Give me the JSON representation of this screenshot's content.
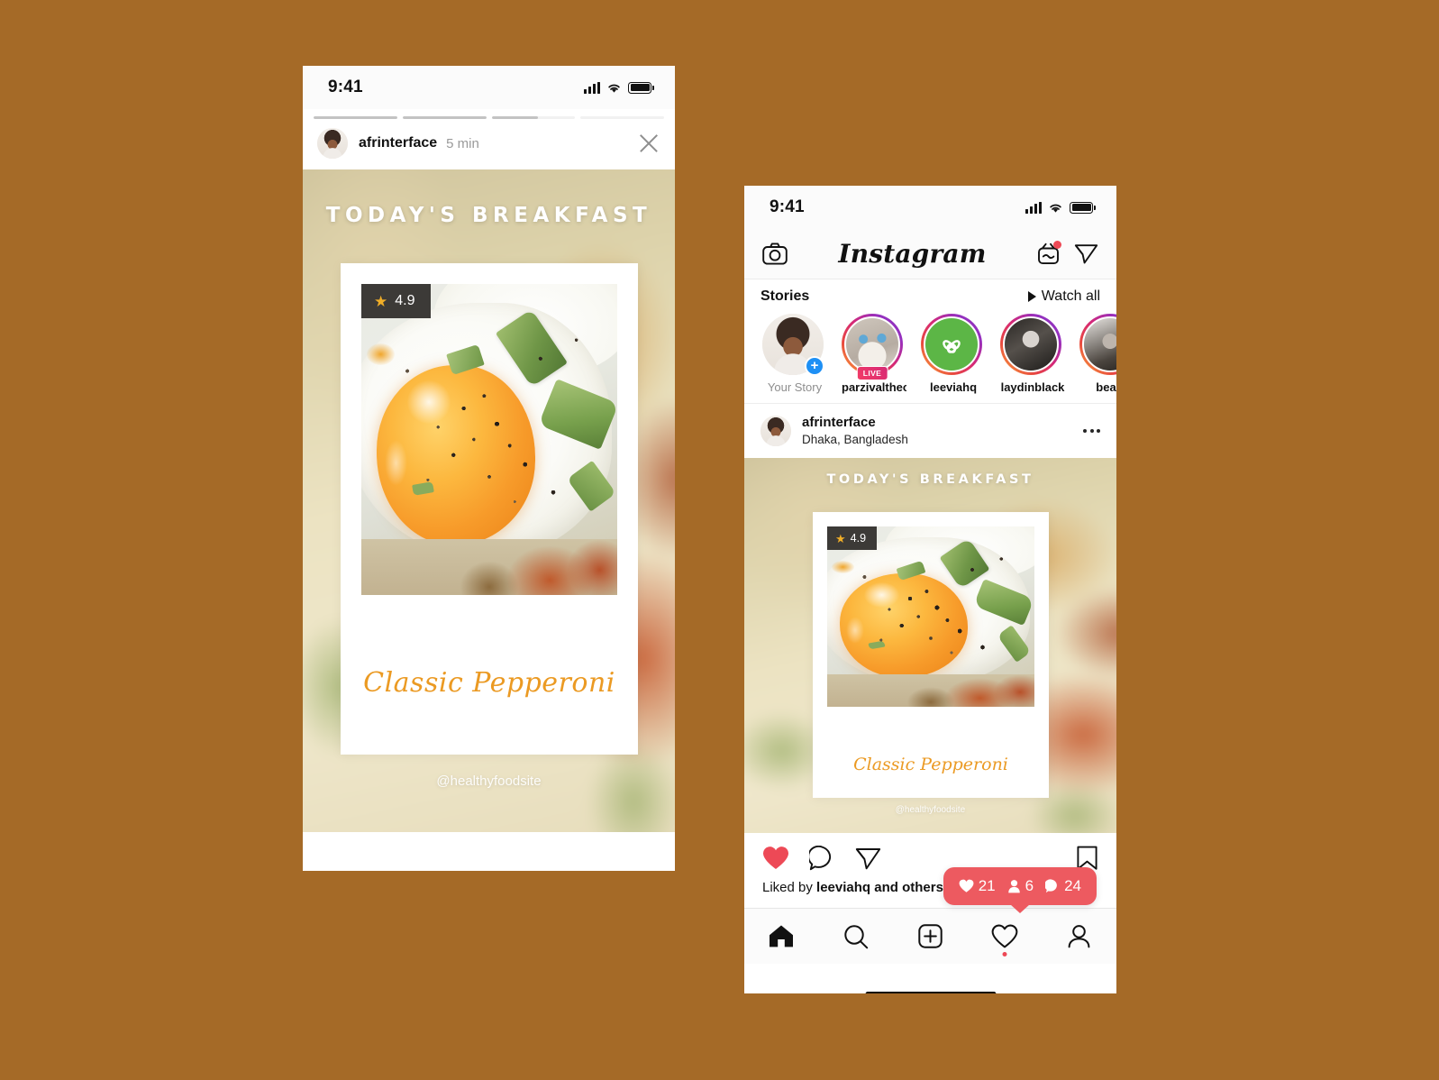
{
  "page": {
    "background_color": "#a56a27"
  },
  "story_phone": {
    "status_bar": {
      "time": "9:41",
      "signal_icon": "cellular-bars-icon",
      "wifi_icon": "wifi-icon",
      "battery_icon": "battery-full-icon"
    },
    "progress": {
      "segments": 4,
      "fills": [
        100,
        100,
        55,
        0
      ]
    },
    "header": {
      "avatar": "afrinterface-avatar",
      "username": "afrinterface",
      "timestamp": "5 min",
      "close_icon": "close-icon"
    },
    "content": {
      "title": "Today's Breakfast",
      "rating": {
        "star_icon": "star-icon",
        "value": "4.9",
        "badge_color": "#3c3a37",
        "star_color": "#f0ae28"
      },
      "signature": "Classic Pepperoni",
      "signature_color": "#eb9a23",
      "watermark": "@healthyfoodsite"
    },
    "home_indicator": "home-indicator"
  },
  "post_phone": {
    "status_bar": {
      "time": "9:41",
      "signal_icon": "cellular-bars-icon",
      "wifi_icon": "wifi-icon",
      "battery_icon": "battery-full-icon"
    },
    "top_bar": {
      "camera_icon": "camera-icon",
      "logo": "Instagram",
      "igtv_icon": "igtv-icon",
      "igtv_has_notification": true,
      "direct_icon": "direct-message-icon"
    },
    "stories": {
      "heading": "Stories",
      "watch_all": "Watch all",
      "watch_all_icon": "play-triangle-icon",
      "items": [
        {
          "name": "Your Story",
          "avatar": "your-story-avatar",
          "has_ring": false,
          "add_badge": "plus-icon",
          "live": false
        },
        {
          "name": "parzivalthecat",
          "avatar": "cat-avatar",
          "has_ring": true,
          "live": true,
          "live_label": "LIVE"
        },
        {
          "name": "leeviahq",
          "avatar": "leaf-logo-avatar",
          "has_ring": true,
          "live": false
        },
        {
          "name": "laydinblack",
          "avatar": "portrait-avatar",
          "has_ring": true,
          "live": false
        },
        {
          "name": "beard",
          "avatar": "beard-avatar",
          "has_ring": true,
          "live": false
        }
      ]
    },
    "post": {
      "avatar": "afrinterface-avatar",
      "username": "afrinterface",
      "location": "Dhaka, Bangladesh",
      "more_icon": "more-options-icon",
      "media": {
        "title": "Today's Breakfast",
        "rating": {
          "star_icon": "star-icon",
          "value": "4.9"
        },
        "signature": "Classic Pepperoni",
        "watermark": "@healthyfoodsite"
      },
      "actions": {
        "like_icon": "heart-filled-icon",
        "like_active": true,
        "comment_icon": "comment-icon",
        "share_icon": "share-icon",
        "save_icon": "bookmark-icon"
      },
      "liked_by_prefix": "Liked by ",
      "liked_by_user": "leeviahq",
      "liked_by_suffix": " and others"
    },
    "engagement_badge": {
      "color": "#ed5a60",
      "likes_icon": "heart-filled-icon",
      "likes": "21",
      "followers_icon": "person-icon",
      "followers": "6",
      "comments_icon": "comment-filled-icon",
      "comments": "24"
    },
    "tab_bar": {
      "items": [
        {
          "name": "home-tab",
          "icon": "home-filled-icon",
          "active": true,
          "dot": false
        },
        {
          "name": "search-tab",
          "icon": "search-icon",
          "active": false,
          "dot": false
        },
        {
          "name": "create-tab",
          "icon": "plus-square-icon",
          "active": false,
          "dot": false
        },
        {
          "name": "activity-tab",
          "icon": "heart-outline-icon",
          "active": false,
          "dot": true
        },
        {
          "name": "profile-tab",
          "icon": "person-outline-icon",
          "active": false,
          "dot": false
        }
      ]
    },
    "home_indicator": "home-indicator"
  }
}
